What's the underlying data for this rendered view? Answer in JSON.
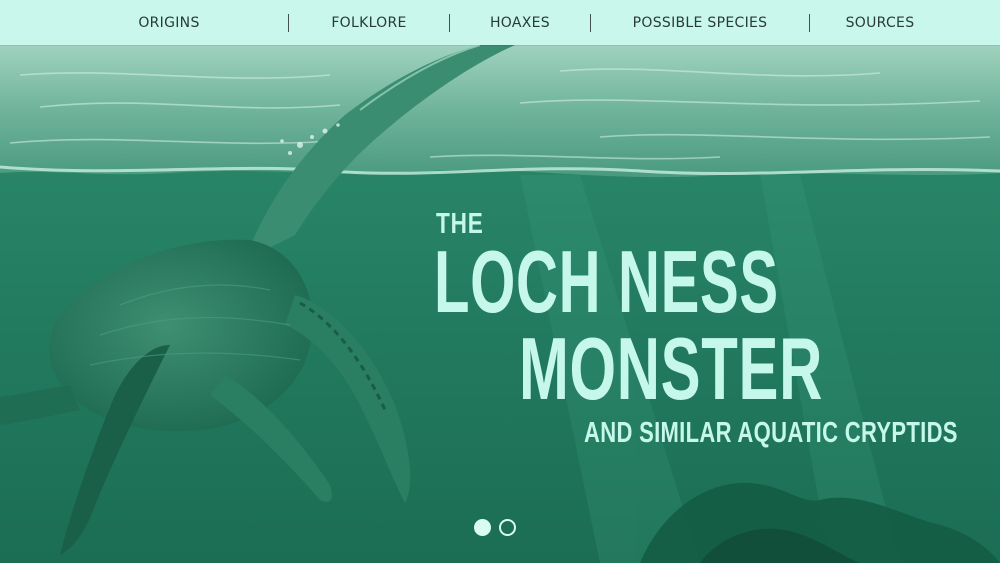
{
  "nav": {
    "items": [
      {
        "label": "ORIGINS"
      },
      {
        "label": "FOLKLORE"
      },
      {
        "label": "HOAXES"
      },
      {
        "label": "POSSIBLE SPECIES"
      },
      {
        "label": "SOURCES"
      }
    ]
  },
  "hero": {
    "title_the": "THE",
    "title_line1": "LOCH NESS",
    "title_line2": "MONSTER",
    "subtitle": "AND SIMILAR AQUATIC CRYPTIDS",
    "image": "plesiosaur-underwater-illustration",
    "slides": {
      "count": 2,
      "active": 1
    }
  },
  "colors": {
    "nav_bg": "#c9f7ec",
    "water": "#1f7a5e",
    "title_text": "#c5f7ea"
  }
}
